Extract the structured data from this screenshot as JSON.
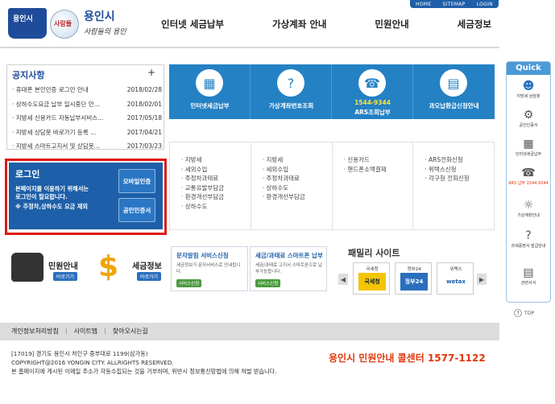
{
  "header": {
    "topbar": [
      "HOME",
      "SITEMAP",
      "LOGIN"
    ],
    "logo_book": "용인시",
    "logo_emblem": "사람들",
    "logo_name": "용인시",
    "logo_sub": "사람들의 용인",
    "gnb": [
      "인터넷 세금납부",
      "가상계좌 안내",
      "민원안내",
      "세금정보"
    ]
  },
  "notice": {
    "title": "공지사항",
    "more": "+",
    "items": [
      {
        "title": "· 휴대폰 본인인증 로그인 안내",
        "date": "2018/02/28"
      },
      {
        "title": "· 상하수도요금 납부 일시중단 안...",
        "date": "2018/02/01"
      },
      {
        "title": "· 지방세 신용카드 자동납부서비스...",
        "date": "2017/05/18"
      },
      {
        "title": "· 지방세 상담봇 바로가기 등록 ...",
        "date": "2017/04/21"
      },
      {
        "title": "· 지방세 스마트고지서 및 상담봇...",
        "date": "2017/03/23"
      }
    ]
  },
  "services": {
    "internet": "인터넷세금납부",
    "virtual": "가상계좌번호조회",
    "ars_number": "1544-9344",
    "ars": "ARS조회납부",
    "refund": "과오납환급신청안내"
  },
  "payment_lists": {
    "col1": [
      "· 지방세",
      "· 세외수입",
      "· 주정차과태료",
      "· 교통유발부담금",
      "· 환경개선부담금",
      "· 상하수도"
    ],
    "col2": [
      "· 지방세",
      "· 세외수입",
      "· 주정차과태료",
      "· 상하수도",
      "· 환경개선부담금"
    ],
    "col3": [
      "· 신용카드",
      "· 핸드폰소액결제"
    ],
    "col4": [
      "· ARS전화신청",
      "· 위택스신청",
      "· 각구청 전화신청"
    ]
  },
  "login": {
    "title": "로그인",
    "desc1": "본페이지를 이용하기 위해서는",
    "desc2": "로그인이 필요합니다.",
    "desc3": "※ 주정차,상하수도 요금 제외",
    "mobile_btn": "모바일인증",
    "cert_btn": "공인인증서"
  },
  "civil": {
    "label": "민원안내",
    "badge": "바로가기"
  },
  "taxinfo": {
    "label": "세금정보",
    "badge": "바로가기"
  },
  "promo1": {
    "title": "문자알림 서비스신청",
    "desc": "세금정보가 문자서비스로 안내됩니다.",
    "btn": "서비스신청"
  },
  "promo2": {
    "title": "세금/과태료 스마트폰 납부",
    "desc": "세금/과태료 고지서 스마트폰으로 납부가능합니다.",
    "btn": "서비스신청"
  },
  "family": {
    "title": "패밀리 사이트",
    "prev": "◀",
    "next": "▶",
    "sites": [
      {
        "label": "국세청",
        "mark": "국세청"
      },
      {
        "label": "정부24",
        "mark": "정부24"
      },
      {
        "label": "위택스",
        "mark": "wetax"
      }
    ]
  },
  "footer": {
    "links": [
      "개인정보처리방침",
      "사이트맵",
      "찾아오시는길"
    ],
    "sep": "|",
    "addr": "[17019] 경기도 용인시 처인구 중부대로 1199(삼가동)",
    "copyright": "COPYRIGHT@2016 YONGIN CITY. ALLRIGHTS RESERVED.",
    "notice": "본 홈페이지에 게시된 이메일 주소가 자동수집되는 것을 거부하며, 위반시 정보통신망법에 의해 처벌 받습니다.",
    "callcenter": "용인시 민원안내 콜센터 1577-1122"
  },
  "quick": {
    "title": "Quick",
    "items": [
      {
        "label": "지방세 상담봇",
        "icon": "chatbot-icon"
      },
      {
        "label": "공인인증서",
        "icon": "certificate-icon"
      },
      {
        "label": "인터넷세금납부",
        "icon": "calculator-icon"
      },
      {
        "label": "ARS 납부 1544-9344",
        "icon": "phone-icon"
      },
      {
        "label": "가상계좌안내",
        "icon": "bulb-icon"
      },
      {
        "label": "과세증명서 발급안내",
        "icon": "question-icon"
      },
      {
        "label": "관련서식",
        "icon": "document-icon"
      }
    ],
    "top": "TOP"
  }
}
